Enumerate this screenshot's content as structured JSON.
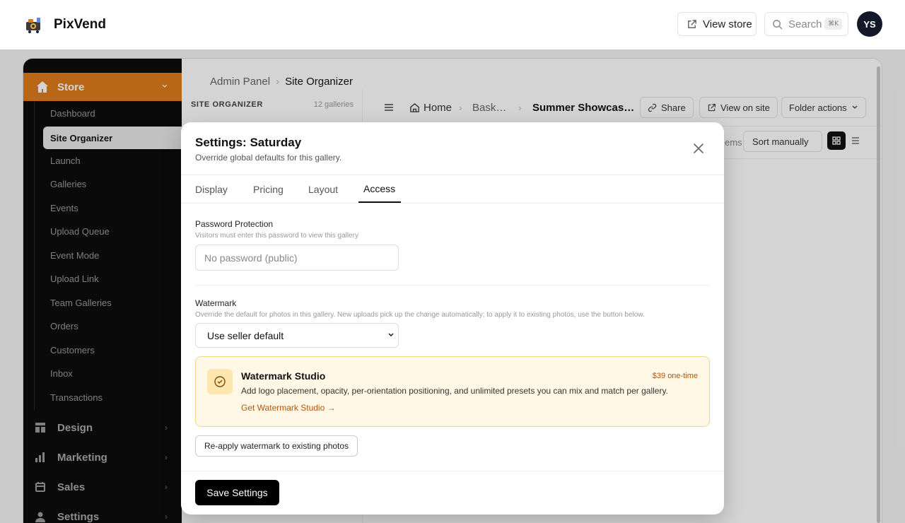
{
  "app": {
    "brand": "PixVend",
    "avatar_initials": "YS",
    "accent": "#e07b1c"
  },
  "topbar": {
    "view_store_label": "View store",
    "search_placeholder": "Search",
    "search_shortcut": "⌘K"
  },
  "sidebar": {
    "store_label": "Store",
    "items": [
      "Dashboard",
      "Site Organizer",
      "Launch",
      "Galleries",
      "Events",
      "Upload Queue",
      "Event Mode",
      "Upload Link",
      "Team Galleries",
      "Orders",
      "Customers",
      "Inbox",
      "Transactions"
    ],
    "active_item": "Site Organizer",
    "sections": [
      "Design",
      "Marketing",
      "Sales",
      "Settings"
    ]
  },
  "breadcrumb": {
    "root": "Admin Panel",
    "current": "Site Organizer"
  },
  "organizer": {
    "heading": "SITE ORGANIZER",
    "count": "12 galleries"
  },
  "gallery_header": {
    "crumbs": [
      "Home",
      "Bask…",
      "Summer Showcas…"
    ],
    "buttons": [
      "Share",
      "View on site",
      "Folder actions"
    ],
    "items_label": "ems",
    "sort_label": "Sort manually"
  },
  "modal": {
    "title": "Settings: Saturday",
    "subtitle": "Override global defaults for this gallery.",
    "tabs": [
      "Display",
      "Pricing",
      "Layout",
      "Access"
    ],
    "active_tab": "Access",
    "password": {
      "label": "Password Protection",
      "help": "Visitors must enter this password to view this gallery",
      "placeholder": "No password (public)"
    },
    "watermark": {
      "label": "Watermark",
      "help": "Override the default for photos in this gallery. New uploads pick up the change automatically; to apply it to existing photos, use the button below.",
      "selected": "Use seller default"
    },
    "promo": {
      "title": "Watermark Studio",
      "price": "$39 one-time",
      "description": "Add logo placement, opacity, per-orientation positioning, and unlimited presets you can mix and match per gallery.",
      "link": "Get Watermark Studio →"
    },
    "reapply_label": "Re-apply watermark to existing photos",
    "save_label": "Save Settings"
  }
}
